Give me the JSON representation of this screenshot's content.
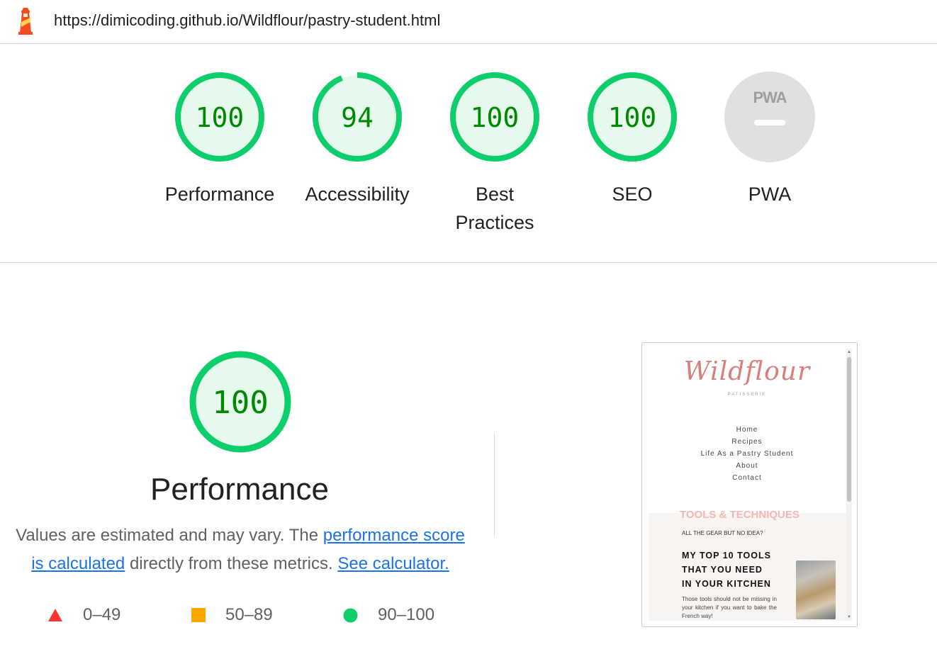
{
  "url": "https://dimicoding.github.io/Wildflour/pastry-student.html",
  "colors": {
    "pass_ring": "#0cce6b",
    "pass_fill": "#e5f9ed",
    "pass_text": "#008800",
    "average": "#ffa400",
    "fail": "#ff3333",
    "na_fill": "#e0e0e0",
    "link": "#1a73e8"
  },
  "gauges": [
    {
      "score": "100",
      "value": 100,
      "label": "Performance"
    },
    {
      "score": "94",
      "value": 94,
      "label": "Accessibility"
    },
    {
      "score": "100",
      "value": 100,
      "label_line1": "Best",
      "label_line2": "Practices"
    },
    {
      "score": "100",
      "value": 100,
      "label": "SEO"
    },
    {
      "score_icon": "PWA",
      "label": "PWA"
    }
  ],
  "performance": {
    "score": "100",
    "value": 100,
    "title": "Performance",
    "desc_prefix": "Values are estimated and may vary. The ",
    "link1": "performance score is calculated",
    "desc_middle": " directly from these metrics. ",
    "link2": "See calculator."
  },
  "legend": [
    {
      "icon": "triangle-fail-icon",
      "range": "0–49"
    },
    {
      "icon": "square-average-icon",
      "range": "50–89"
    },
    {
      "icon": "circle-pass-icon",
      "range": "90–100"
    }
  ],
  "thumbnail": {
    "brand": "Wildflour",
    "brand_sub": "PATISSERIE",
    "nav": [
      "Home",
      "Recipes",
      "Life As a Pastry Student",
      "About",
      "Contact"
    ],
    "tools_heading": "TOOLS & TECHNIQUES",
    "gear_question": "ALL THE GEAR BUT NO IDEA?",
    "top10_line1": "MY TOP 10 TOOLS",
    "top10_line2": "THAT YOU NEED",
    "top10_line3": "IN YOUR KITCHEN",
    "tools_desc": "Those tools should not be missing in your kitchen if you want to bake the French way!"
  }
}
